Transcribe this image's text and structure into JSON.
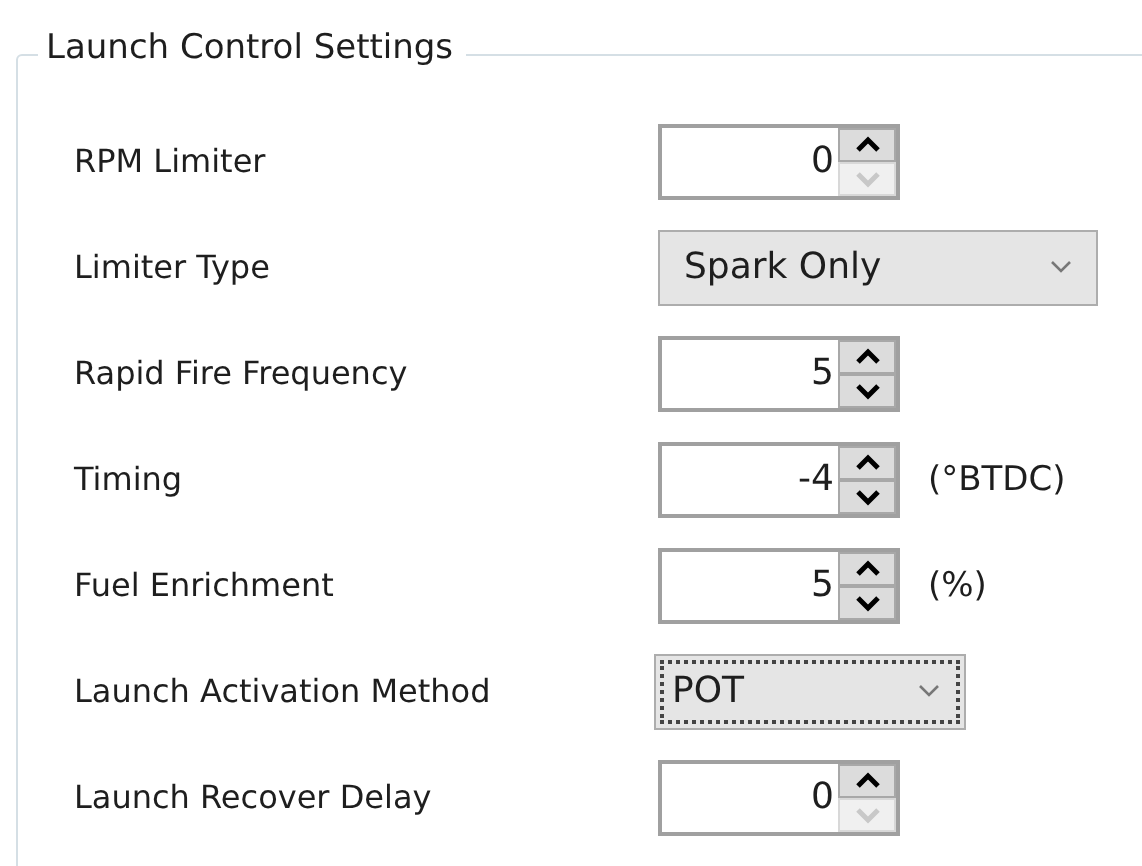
{
  "group": {
    "title": "Launch Control Settings"
  },
  "rows": [
    {
      "label": "RPM Limiter",
      "kind": "spinner",
      "value": "0",
      "down_disabled": true
    },
    {
      "label": "Limiter Type",
      "kind": "dropdown",
      "value": "Spark Only",
      "focused": false
    },
    {
      "label": "Rapid Fire Frequency",
      "kind": "spinner",
      "value": "5",
      "down_disabled": false
    },
    {
      "label": "Timing",
      "kind": "spinner",
      "value": "-4",
      "down_disabled": false,
      "unit": "(°BTDC)"
    },
    {
      "label": "Fuel Enrichment",
      "kind": "spinner",
      "value": "5",
      "down_disabled": false,
      "unit": "(%)"
    },
    {
      "label": "Launch Activation Method",
      "kind": "dropdown",
      "value": "POT",
      "focused": true
    },
    {
      "label": "Launch Recover Delay",
      "kind": "spinner",
      "value": "0",
      "down_disabled": true
    }
  ]
}
